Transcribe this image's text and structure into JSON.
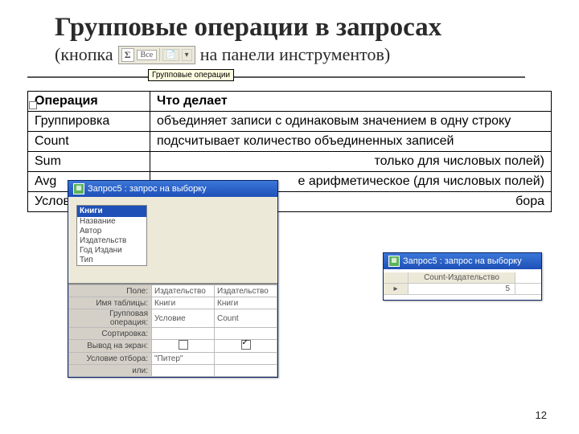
{
  "title": "Групповые операции в запросах",
  "subtitle_pre": "(кнопка",
  "subtitle_post": "на панели инструментов)",
  "toolbar": {
    "sigma": "Σ",
    "dropdown": "Все",
    "tooltip": "Групповые операции"
  },
  "table": {
    "head_op": "Операция",
    "head_desc": "Что делает",
    "rows": [
      {
        "op": "Группировка",
        "desc": "объединяет записи с одинаковым значением в одну строку"
      },
      {
        "op": "Count",
        "desc": "подсчитывает количество объединенных записей"
      },
      {
        "op": "Sum",
        "desc": "только для числовых полей)"
      },
      {
        "op": "Avg",
        "desc": "е арифметическое  (для числовых полей)"
      },
      {
        "op": "Услов",
        "desc": "бора"
      }
    ]
  },
  "win1": {
    "title": "Запрос5 : запрос на выборку",
    "list_title": "Книги",
    "list_items": [
      "Название",
      "Автор",
      "Издательств",
      "Год Издани",
      "Тип"
    ],
    "grid_labels": [
      "Поле:",
      "Имя таблицы:",
      "Групповая операция:",
      "Сортировка:",
      "Вывод на экран:",
      "Условие отбора:",
      "или:"
    ],
    "col1": [
      "Издательство",
      "Книги",
      "Условие",
      "",
      "",
      "\"Питер\"",
      ""
    ],
    "col2": [
      "Издательство",
      "Книги",
      "Count",
      "",
      "",
      "",
      ""
    ]
  },
  "win2": {
    "title": "Запрос5 : запрос на выборку",
    "col_head": "Count-Издательство",
    "value": "5"
  },
  "page": "12"
}
